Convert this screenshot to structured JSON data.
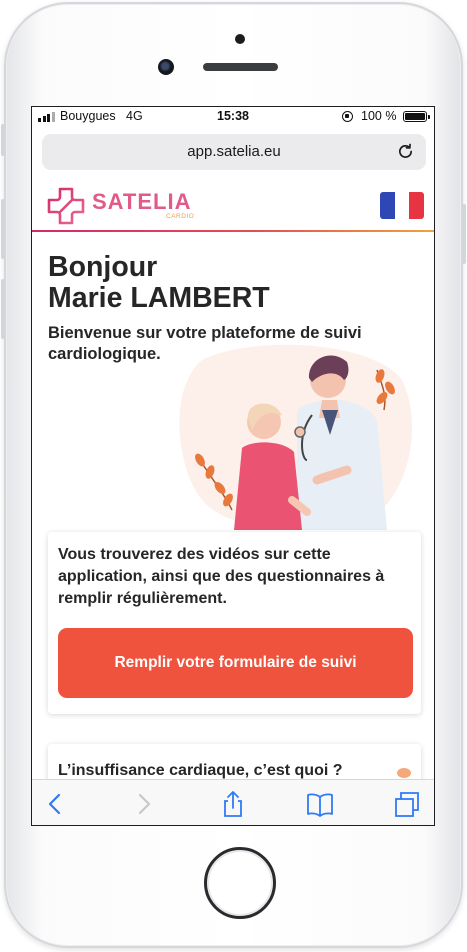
{
  "status_bar": {
    "carrier": "Bouygues",
    "network": "4G",
    "time": "15:38",
    "battery": "100 %"
  },
  "browser": {
    "url": "app.satelia.eu",
    "icons": [
      "reload-icon",
      "back-icon",
      "forward-icon",
      "share-icon",
      "bookmarks-icon",
      "tabs-icon"
    ]
  },
  "header": {
    "logo": "SATELIA",
    "logo_sub": "CARDIO",
    "language_flag": "flag-france",
    "colors": {
      "brand_pink": "#d2296a",
      "brand_orange": "#f2a33c"
    }
  },
  "main": {
    "greeting_line1": "Bonjour",
    "greeting_line2": "Marie LAMBERT",
    "welcome": "Bienvenue sur votre plateforme de suivi cardiologique.",
    "info_text": "Vous trouverez des vidéos sur cette application, ainsi que des questionnaires à remplir régulièrement.",
    "cta_label": "Remplir votre formulaire de suivi",
    "cta_color": "#f0533d",
    "section2_title": "L’insuffisance cardiaque, c’est quoi ?"
  }
}
